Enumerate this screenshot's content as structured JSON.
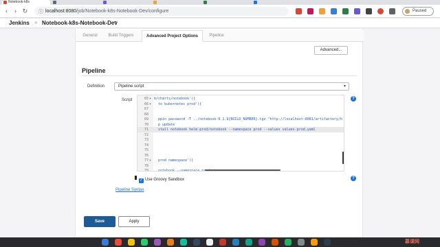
{
  "browser": {
    "tabs": [
      {
        "title": "Notebook-k8s",
        "active": true,
        "color": "#d24939"
      },
      {
        "title": "",
        "active": false,
        "color": "#5b6b7c"
      },
      {
        "title": "",
        "active": false,
        "color": "#6a5acd"
      },
      {
        "title": "",
        "active": false,
        "color": "#e8a33d"
      },
      {
        "title": "",
        "active": false,
        "color": "#2d7d46"
      },
      {
        "title": "",
        "active": false,
        "color": "#1a73e8"
      }
    ],
    "url_host": "localhost:8080",
    "url_path": "/job/Notebook-k8s-Notebook-Dev/configure",
    "profile_status": "Paused",
    "icons": [
      "back-icon",
      "forward-icon",
      "reload-icon",
      "lock-icon"
    ]
  },
  "jenkins": {
    "logo": "Jenkins",
    "breadcrumb_sep": "»",
    "job_name": "Notebook-k8s-Notebook-Dev",
    "job_caret": "▾"
  },
  "config": {
    "tabs": [
      {
        "label": "General",
        "active": false
      },
      {
        "label": "Build Triggers",
        "active": false
      },
      {
        "label": "Advanced Project Options",
        "active": true
      },
      {
        "label": "Pipeline",
        "active": false
      }
    ],
    "advanced_button": "Advanced...",
    "section_title": "Pipeline",
    "definition_label": "Definition",
    "definition_value": "Pipeline script",
    "script_label": "Script",
    "help_glyph": "?",
    "editor_lines": [
      {
        "num": "65",
        "fold": "▾",
        "code": "b/charts/notebook'){",
        "current": false
      },
      {
        "num": "66",
        "fold": "▾",
        "code": "  to kubernetes prod'){",
        "current": false
      },
      {
        "num": "67",
        "fold": "",
        "code": "",
        "current": false
      },
      {
        "num": "68",
        "fold": "",
        "code": "",
        "current": false
      },
      {
        "num": "69",
        "fold": "",
        "code": "  ppin password -T ../notebook-0.1.${BUILD_NUMBER}.tgz \"http://localhost:8081/artifactory/h",
        "current": false
      },
      {
        "num": "70",
        "fold": "",
        "code": "  p update",
        "current": false
      },
      {
        "num": "71",
        "fold": "",
        "code": "  stall notebook helm-prod/notebook --namespace prod --values values-prod.yaml",
        "current": true
      },
      {
        "num": "72",
        "fold": "",
        "code": "",
        "current": false
      },
      {
        "num": "73",
        "fold": "",
        "code": "",
        "current": false
      },
      {
        "num": "74",
        "fold": "",
        "code": "",
        "current": false
      },
      {
        "num": "75",
        "fold": "",
        "code": "",
        "current": false
      },
      {
        "num": "76",
        "fold": "",
        "code": "",
        "current": false
      },
      {
        "num": "77",
        "fold": "▾",
        "code": "  prod namespace'){",
        "current": false
      },
      {
        "num": "78",
        "fold": "",
        "code": "",
        "current": false
      },
      {
        "num": "79",
        "fold": "",
        "code": "  notebook --namespace prod",
        "current": false
      }
    ],
    "sandbox_checked": true,
    "sandbox_label": "Use Groovy Sandbox",
    "syntax_link": "Pipeline Syntax",
    "save_label": "Save",
    "apply_label": "Apply"
  },
  "dock": {
    "icon_colors": [
      "#3a7bd5",
      "#e74c3c",
      "#f1c40f",
      "#2ecc71",
      "#9b59b6",
      "#e67e22",
      "#1abc9c",
      "#34495e",
      "#ecf0f1",
      "#c0392b",
      "#2980b9",
      "#16a085",
      "#8e44ad",
      "#d35400",
      "#27ae60",
      "#7f8c8d",
      "#f39c12",
      "#2c3e50"
    ]
  }
}
